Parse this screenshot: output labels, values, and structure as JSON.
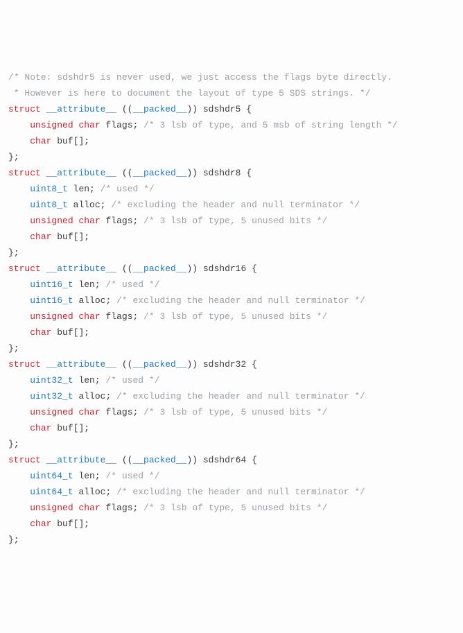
{
  "code": {
    "indent": "    ",
    "note1": "/* Note: sdshdr5 is never used, we just access the flags byte directly.",
    "note2": " * However is here to document the layout of type 5 SDS strings. */",
    "kw_struct": "struct",
    "kw_attribute": "__attribute__",
    "kw_packed": "__packed__",
    "kw_unsigned": "unsigned",
    "kw_char": "char",
    "id_flags": "flags",
    "id_buf": "buf",
    "id_len": "len",
    "id_alloc": "alloc",
    "brace_open": " {",
    "brace_close": "};",
    "paren_open": " ((",
    "paren_mid": ")) ",
    "arr": "[];",
    "semi": ";",
    "sp": " ",
    "sdshdr5": {
      "name": "sdshdr5",
      "flags_comment": "/* 3 lsb of type, and 5 msb of string length */"
    },
    "sdshdr8": {
      "name": "sdshdr8",
      "t": "uint8_t"
    },
    "sdshdr16": {
      "name": "sdshdr16",
      "t": "uint16_t"
    },
    "sdshdr32": {
      "name": "sdshdr32",
      "t": "uint32_t"
    },
    "sdshdr64": {
      "name": "sdshdr64",
      "t": "uint64_t"
    },
    "cm_used": "/* used */",
    "cm_alloc": "/* excluding the header and null terminator */",
    "cm_flags": "/* 3 lsb of type, 5 unused bits */"
  }
}
